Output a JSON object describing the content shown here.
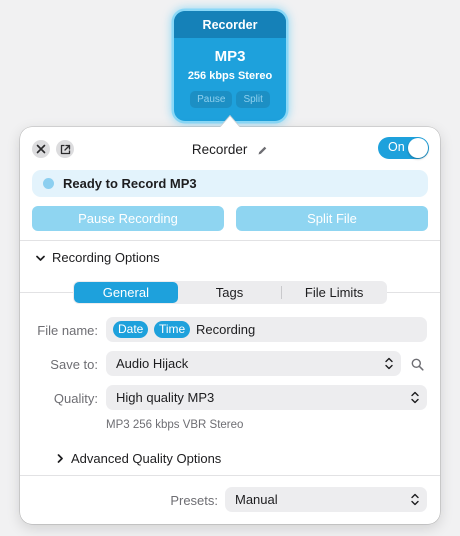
{
  "block": {
    "title": "Recorder",
    "format": "MP3",
    "quality": "256 kbps Stereo",
    "pause_label": "Pause",
    "split_label": "Split"
  },
  "header": {
    "title": "Recorder",
    "toggle_label": "On",
    "toggle_on": true
  },
  "status": {
    "text": "Ready to Record MP3"
  },
  "actions": {
    "pause_label": "Pause Recording",
    "split_label": "Split File"
  },
  "recording_options": {
    "label": "Recording Options",
    "tabs": [
      {
        "label": "General",
        "active": true
      },
      {
        "label": "Tags",
        "active": false
      },
      {
        "label": "File Limits",
        "active": false
      }
    ]
  },
  "form": {
    "file_name_label": "File name:",
    "file_name_tokens": [
      "Date",
      "Time"
    ],
    "file_name_text": "Recording",
    "save_to_label": "Save to:",
    "save_to_value": "Audio Hijack",
    "quality_label": "Quality:",
    "quality_value": "High quality MP3",
    "quality_description": "MP3 256 kbps VBR Stereo"
  },
  "advanced": {
    "label": "Advanced Quality Options"
  },
  "presets": {
    "label": "Presets:",
    "value": "Manual"
  },
  "colors": {
    "accent": "#1ea1dc",
    "block_header": "#1581b8",
    "status_bg": "#e3f3fc",
    "disabled_button": "#8fd5f1"
  },
  "icons": {
    "close": "close-icon",
    "popout": "popout-icon",
    "edit": "pencil-icon",
    "search": "search-icon"
  }
}
